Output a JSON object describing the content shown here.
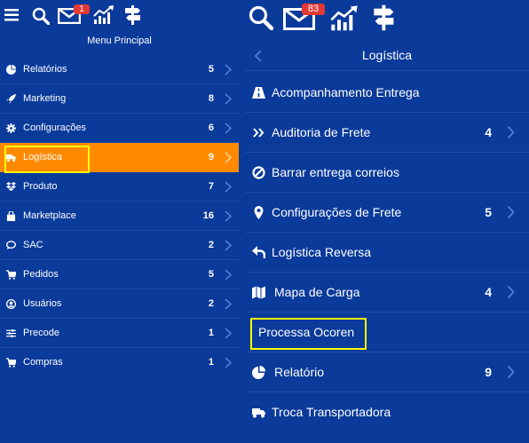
{
  "colors": {
    "background": "#0a3a9a",
    "active_row": "#ff8a00",
    "highlight": "#ffff00",
    "badge": "#e53935"
  },
  "left_panel": {
    "header": {
      "icons": [
        "menu-icon",
        "search-icon",
        "mail-icon",
        "chart-icon",
        "signpost-icon"
      ],
      "mail_badge": "1"
    },
    "title": "Menu Principal",
    "items": [
      {
        "label": "Relatórios",
        "count": "5",
        "icon": "pie-chart-icon"
      },
      {
        "label": "Marketing",
        "count": "8",
        "icon": "rocket-icon"
      },
      {
        "label": "Configurações",
        "count": "6",
        "icon": "gear-icon"
      },
      {
        "label": "Logística",
        "count": "9",
        "icon": "truck-icon",
        "active": true
      },
      {
        "label": "Produto",
        "count": "7",
        "icon": "dropbox-icon"
      },
      {
        "label": "Marketplace",
        "count": "16",
        "icon": "bag-icon"
      },
      {
        "label": "SAC",
        "count": "2",
        "icon": "chat-icon"
      },
      {
        "label": "Pedidos",
        "count": "5",
        "icon": "cart-icon"
      },
      {
        "label": "Usuários",
        "count": "2",
        "icon": "user-icon"
      },
      {
        "label": "Precode",
        "count": "1",
        "icon": "sliders-icon"
      },
      {
        "label": "Compras",
        "count": "1",
        "icon": "cart-icon"
      }
    ]
  },
  "right_panel": {
    "header": {
      "icons": [
        "search-icon",
        "mail-icon",
        "chart-icon",
        "signpost-icon"
      ],
      "mail_badge": "83"
    },
    "title": "Logística",
    "items": [
      {
        "label": "Acompanhamento Entrega",
        "count": "",
        "icon": "road-icon"
      },
      {
        "label": "Auditoria de Frete",
        "count": "4",
        "icon": "double-chevron-icon"
      },
      {
        "label": "Barrar entrega correios",
        "count": "",
        "icon": "ban-icon"
      },
      {
        "label": "Configurações de Frete",
        "count": "5",
        "icon": "map-marker-icon"
      },
      {
        "label": "Logística Reversa",
        "count": "",
        "icon": "reply-icon"
      },
      {
        "label": "Mapa de Carga",
        "count": "4",
        "icon": "map-icon"
      },
      {
        "label": "Processa Ocoren",
        "count": "",
        "icon": ""
      },
      {
        "label": "Relatório",
        "count": "9",
        "icon": "pie-chart-icon"
      },
      {
        "label": "Troca Transportadora",
        "count": "",
        "icon": "truck-icon"
      }
    ]
  }
}
